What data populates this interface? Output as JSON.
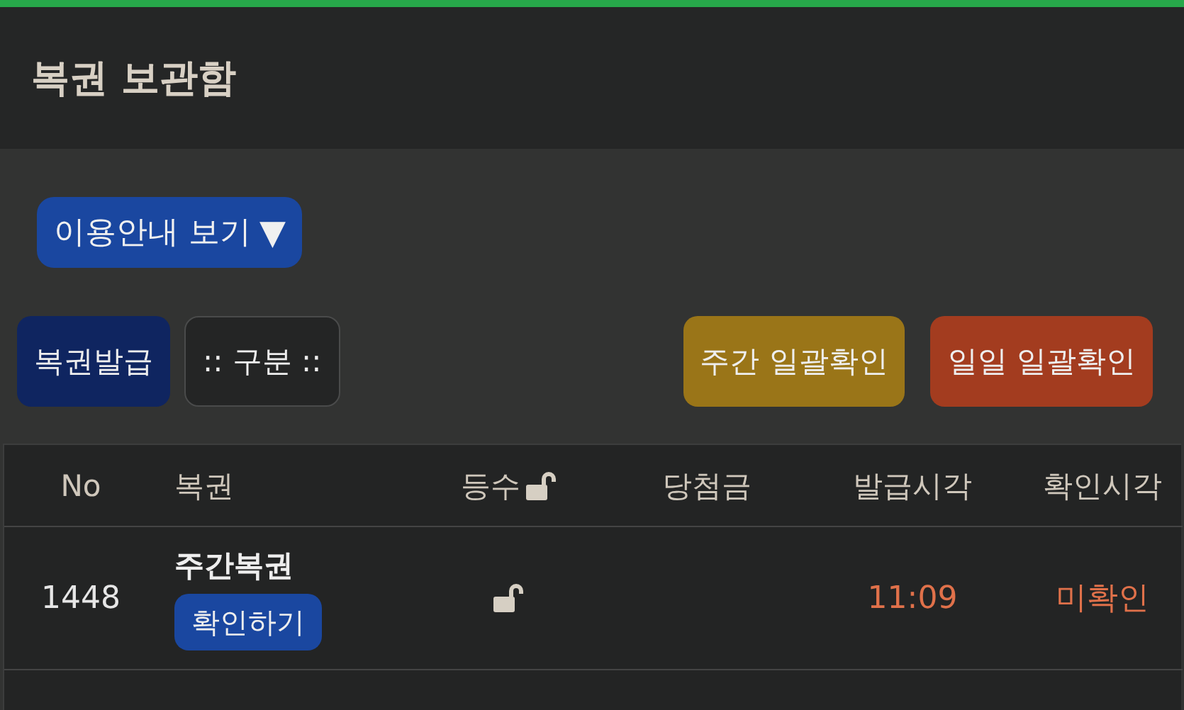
{
  "header": {
    "title": "복권 보관함"
  },
  "guide_button": {
    "label": "이용안내 보기",
    "arrow": "▼"
  },
  "actions": [
    {
      "label": "복권발급",
      "kind": "issue"
    },
    {
      "label": ":: 구분 ::",
      "kind": "filter"
    },
    {
      "label": "주간 일괄확인",
      "kind": "weekly"
    },
    {
      "label": "일일 일괄확인",
      "kind": "daily"
    }
  ],
  "table": {
    "columns": [
      "No",
      "복권",
      "등수",
      "당첨금",
      "발급시각",
      "확인시각"
    ],
    "rows": [
      {
        "no": "1448",
        "name": "주간복권",
        "action": "확인하기",
        "issued": "11:09",
        "confirmed": "미확인"
      }
    ]
  }
}
